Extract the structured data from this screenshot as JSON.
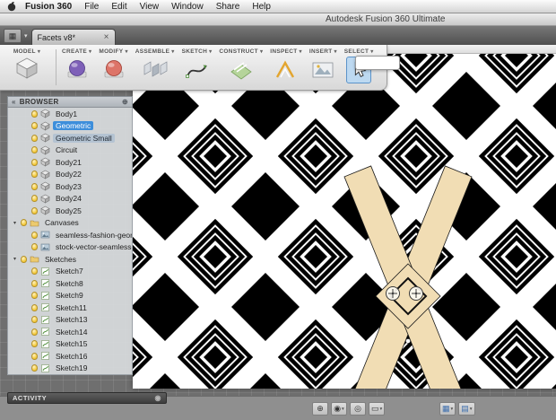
{
  "colors": {
    "selection_blue": "#3d8edb",
    "selection_tan": "#f1ddb4",
    "pattern_black": "#000000",
    "pattern_white": "#ffffff"
  },
  "menubar": {
    "app_name": "Fusion 360",
    "items": [
      "File",
      "Edit",
      "View",
      "Window",
      "Share",
      "Help"
    ]
  },
  "titlebar": {
    "title": "Autodesk Fusion 360 Ultimate"
  },
  "tabbar": {
    "active_tab": "Facets v8*",
    "close": "×"
  },
  "ribbon": {
    "mode_label": "MODEL",
    "groups": [
      {
        "label": "CREATE",
        "icon": "create-sphere-icon"
      },
      {
        "label": "MODIFY",
        "icon": "modify-sphere-icon"
      },
      {
        "label": "ASSEMBLE",
        "icon": "assemble-icon"
      },
      {
        "label": "SKETCH",
        "icon": "sketch-spline-icon"
      },
      {
        "label": "CONSTRUCT",
        "icon": "construct-plane-icon"
      },
      {
        "label": "INSPECT",
        "icon": "inspect-measure-icon"
      },
      {
        "label": "INSERT",
        "icon": "insert-image-icon"
      },
      {
        "label": "SELECT",
        "icon": "select-cursor-icon",
        "highlighted": true
      }
    ]
  },
  "browser": {
    "title": "BROWSER",
    "items": [
      {
        "label": "Body1",
        "type": "body",
        "child": true
      },
      {
        "label": "Geometric",
        "type": "body",
        "child": true,
        "selected": "primary"
      },
      {
        "label": "Geometric Small",
        "type": "body",
        "child": true,
        "selected": "secondary"
      },
      {
        "label": "Circuit",
        "type": "body",
        "child": true
      },
      {
        "label": "Body21",
        "type": "body",
        "child": true
      },
      {
        "label": "Body22",
        "type": "body",
        "child": true
      },
      {
        "label": "Body23",
        "type": "body",
        "child": true
      },
      {
        "label": "Body24",
        "type": "body",
        "child": true
      },
      {
        "label": "Body25",
        "type": "body",
        "child": true
      },
      {
        "label": "Canvases",
        "type": "folder",
        "expanded": true
      },
      {
        "label": "seamless-fashion-geometri...",
        "type": "canvas",
        "child": true
      },
      {
        "label": "stock-vector-seamless-pri...",
        "type": "canvas",
        "child": true
      },
      {
        "label": "Sketches",
        "type": "folder",
        "expanded": true
      },
      {
        "label": "Sketch7",
        "type": "sketch",
        "child": true
      },
      {
        "label": "Sketch8",
        "type": "sketch",
        "child": true
      },
      {
        "label": "Sketch9",
        "type": "sketch",
        "child": true
      },
      {
        "label": "Sketch11",
        "type": "sketch",
        "child": true
      },
      {
        "label": "Sketch13",
        "type": "sketch",
        "child": true
      },
      {
        "label": "Sketch14",
        "type": "sketch",
        "child": true
      },
      {
        "label": "Sketch15",
        "type": "sketch",
        "child": true
      },
      {
        "label": "Sketch16",
        "type": "sketch",
        "child": true
      },
      {
        "label": "Sketch19",
        "type": "sketch",
        "child": true
      }
    ]
  },
  "activity": {
    "label": "ACTIVITY"
  },
  "navbar": {
    "buttons": [
      {
        "name": "pan-icon",
        "glyph": "⊕",
        "dropdown": false
      },
      {
        "name": "orbit-icon",
        "glyph": "◉",
        "dropdown": true
      },
      {
        "name": "look-at-icon",
        "glyph": "◎",
        "dropdown": false
      },
      {
        "name": "fit-icon",
        "glyph": "▭",
        "dropdown": true
      }
    ],
    "display_buttons": [
      {
        "name": "display-settings-icon",
        "glyph": "▦",
        "dropdown": true
      },
      {
        "name": "grid-layout-icon",
        "glyph": "▤",
        "dropdown": true
      }
    ]
  }
}
